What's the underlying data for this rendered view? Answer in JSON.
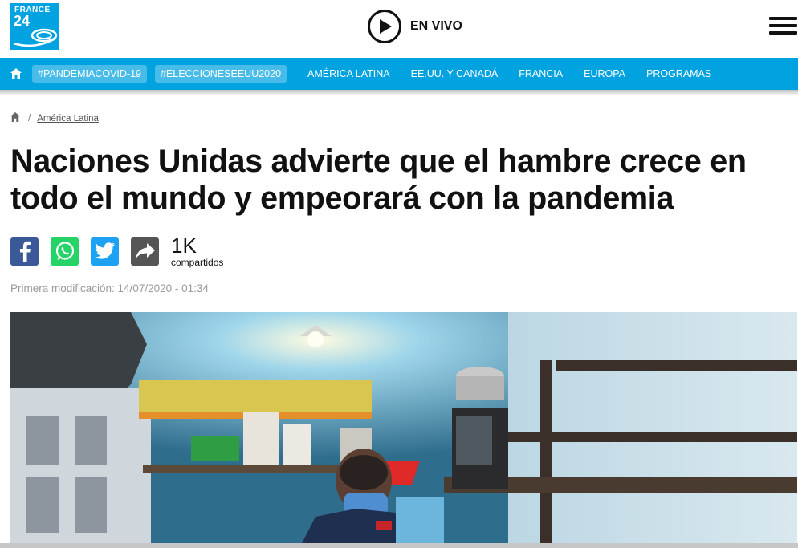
{
  "header": {
    "logo_line1": "FRANCE",
    "logo_line2": "24",
    "live_label": "EN VIVO",
    "play_icon": "play-icon",
    "menu_icon": "hamburger-menu-icon"
  },
  "nav": {
    "home_icon": "home-icon",
    "tags": [
      "#PANDEMIACOVID-19",
      "#ELECCIONESEEUU2020"
    ],
    "links": [
      "AMÉRICA LATINA",
      "EE.UU. Y CANADÁ",
      "FRANCIA",
      "EUROPA",
      "PROGRAMAS"
    ]
  },
  "breadcrumb": {
    "home_icon": "home-icon",
    "separator": "/",
    "section": "América Latina"
  },
  "article": {
    "title": "Naciones Unidas advierte que el hambre crece en todo el mundo y empeorará con la pandemia",
    "modified": "Primera modificación: 14/07/2020 - 01:34"
  },
  "share": {
    "buttons": [
      "facebook-icon",
      "whatsapp-icon",
      "twitter-icon",
      "share-icon"
    ],
    "count": "1K",
    "count_label": "compartidos"
  },
  "colors": {
    "brand_blue": "#00a2e0",
    "facebook": "#3b5998",
    "whatsapp": "#25d366",
    "twitter": "#1da1f2",
    "share": "#555555"
  }
}
